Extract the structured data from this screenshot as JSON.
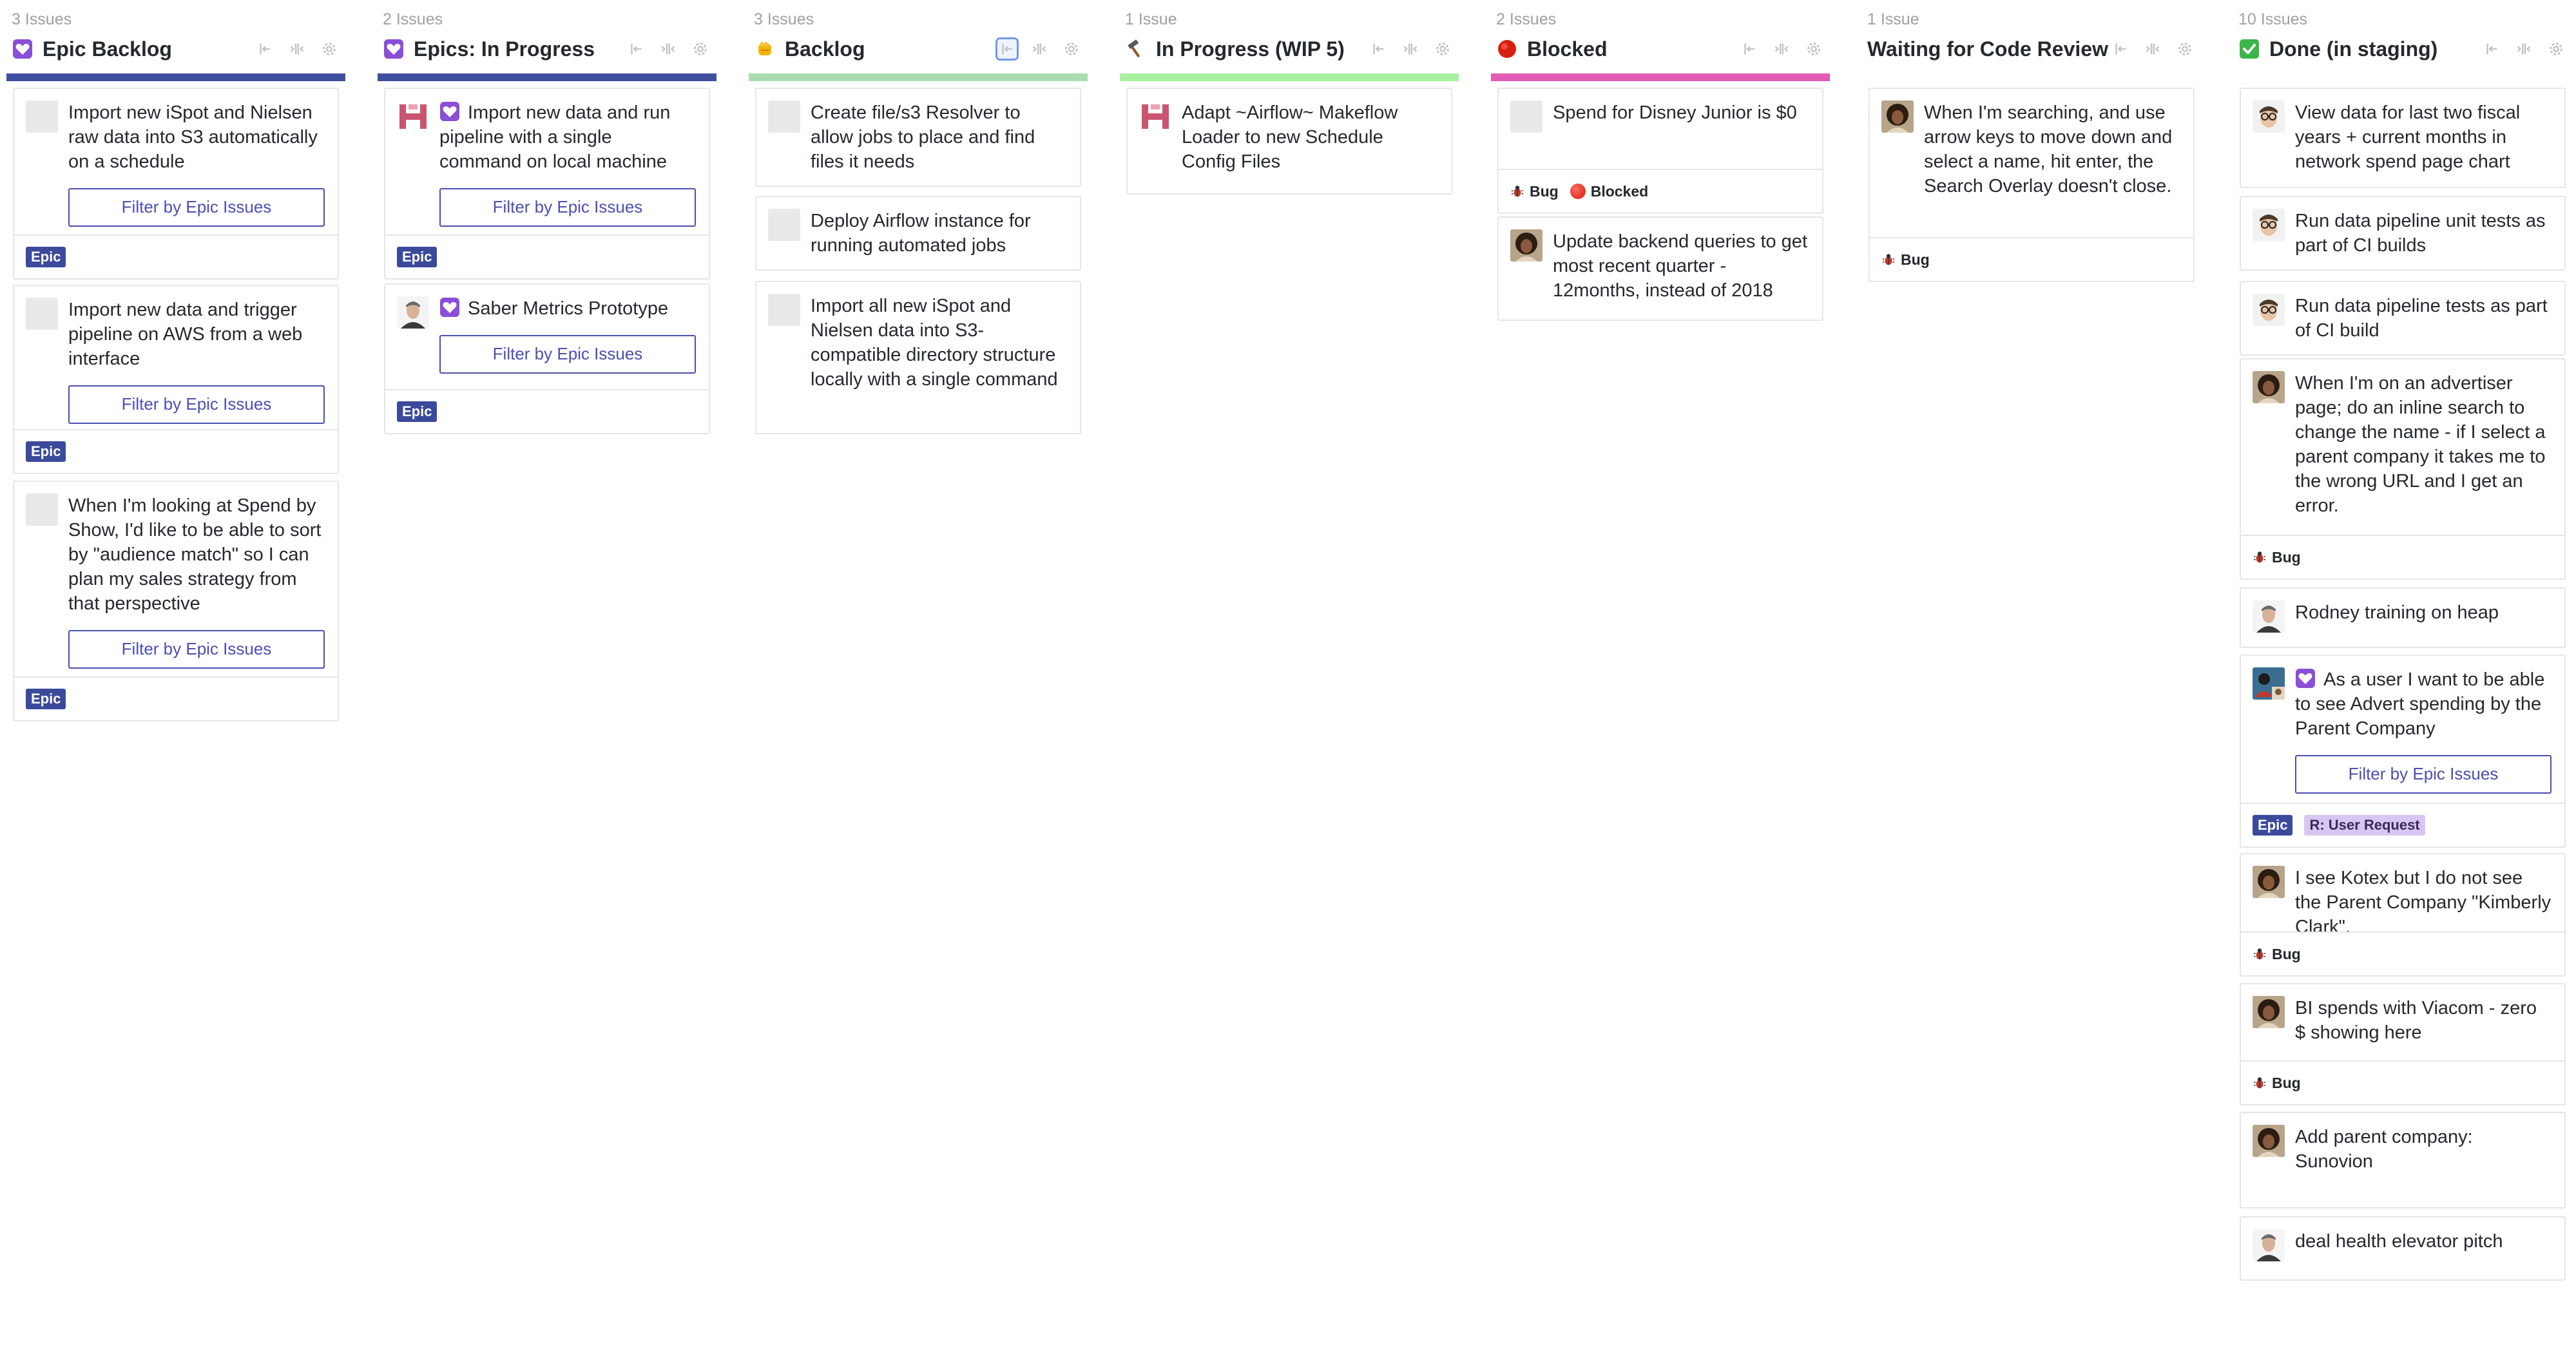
{
  "bar_colors": [
    "#3f4fa0",
    "#3f4fa0",
    "#a8ddb0",
    "#a8f0a0",
    "#e35bb5",
    "#ffffff",
    "#ffffff"
  ],
  "columns": [
    {
      "count": "3 Issues",
      "title": "Epic Backlog",
      "icon": "epic-icon",
      "cards": [
        {
          "title": "Import new iSpot and Nielsen raw data into S3 automatically on a schedule",
          "button": "Filter by Epic Issues",
          "labels": [
            "Epic"
          ]
        },
        {
          "title": "Import new data and trigger pipeline on AWS from a web interface",
          "button": "Filter by Epic Issues",
          "labels": [
            "Epic"
          ]
        },
        {
          "title": "When I'm looking at Spend by Show, I'd like to be able to sort by \"audience match\" so I can plan my sales strategy from that perspective",
          "button": "Filter by Epic Issues",
          "labels": [
            "Epic"
          ]
        }
      ]
    },
    {
      "count": "2 Issues",
      "title": "Epics: In Progress",
      "icon": "epic-icon",
      "cards": [
        {
          "title": "Import new data and run pipeline with a single command on local machine",
          "button": "Filter by Epic Issues",
          "labels": [
            "Epic"
          ]
        },
        {
          "title": "Saber Metrics Prototype",
          "button": "Filter by Epic Issues",
          "labels": [
            "Epic"
          ]
        }
      ]
    },
    {
      "count": "3 Issues",
      "title": "Backlog",
      "icon": "fist-icon",
      "cards": [
        {
          "title": "Create file/s3 Resolver to allow jobs to place and find files it needs"
        },
        {
          "title": "Deploy Airflow instance for running automated jobs"
        },
        {
          "title": "Import all new iSpot and Nielsen data into S3-compatible directory structure locally with a single command"
        }
      ]
    },
    {
      "count": "1 Issue",
      "title": "In Progress (WIP 5)",
      "icon": "hammer-icon",
      "cards": [
        {
          "title": "Adapt ~Airflow~ Makeflow Loader to new Schedule Config Files"
        }
      ]
    },
    {
      "count": "2 Issues",
      "title": "Blocked",
      "icon": "red-circle-icon",
      "cards": [
        {
          "title": "Spend for Disney Junior is $0",
          "labels": [
            "Bug",
            "Blocked"
          ]
        },
        {
          "title": "Update backend queries to get most recent quarter - 12months, instead of 2018"
        }
      ]
    },
    {
      "count": "1 Issue",
      "title": "Waiting for Code Review",
      "icon": "",
      "cards": [
        {
          "title": "When I'm searching, and use arrow keys to move down and select a name, hit enter, the Search Overlay doesn't close.",
          "labels": [
            "Bug"
          ]
        }
      ]
    },
    {
      "count": "10 Issues",
      "title": "Done (in staging)",
      "icon": "check-icon",
      "cards": [
        {
          "title": "View data for last two fiscal years + current months in network spend page chart"
        },
        {
          "title": "Run data pipeline unit tests as part of CI builds"
        },
        {
          "title": "Run data pipeline tests as part of CI build"
        },
        {
          "title": "When I'm on an advertiser page; do an inline search to change the name - if I select a parent company it takes me to the wrong URL and I get an error.",
          "labels": [
            "Bug"
          ]
        },
        {
          "title": "Rodney training on heap"
        },
        {
          "title": "As a user I want to be able to see Advert spending by the Parent Company",
          "button": "Filter by Epic Issues",
          "labels": [
            "Epic",
            "R: User Request"
          ]
        },
        {
          "title": "I see Kotex but I do not see the Parent Company \"Kimberly Clark\".",
          "labels": [
            "Bug"
          ]
        },
        {
          "title": "BI spends with Viacom - zero $ showing here",
          "labels": [
            "Bug"
          ]
        },
        {
          "title": "Add parent company: Sunovion"
        },
        {
          "title": "deal health elevator pitch"
        }
      ]
    }
  ]
}
